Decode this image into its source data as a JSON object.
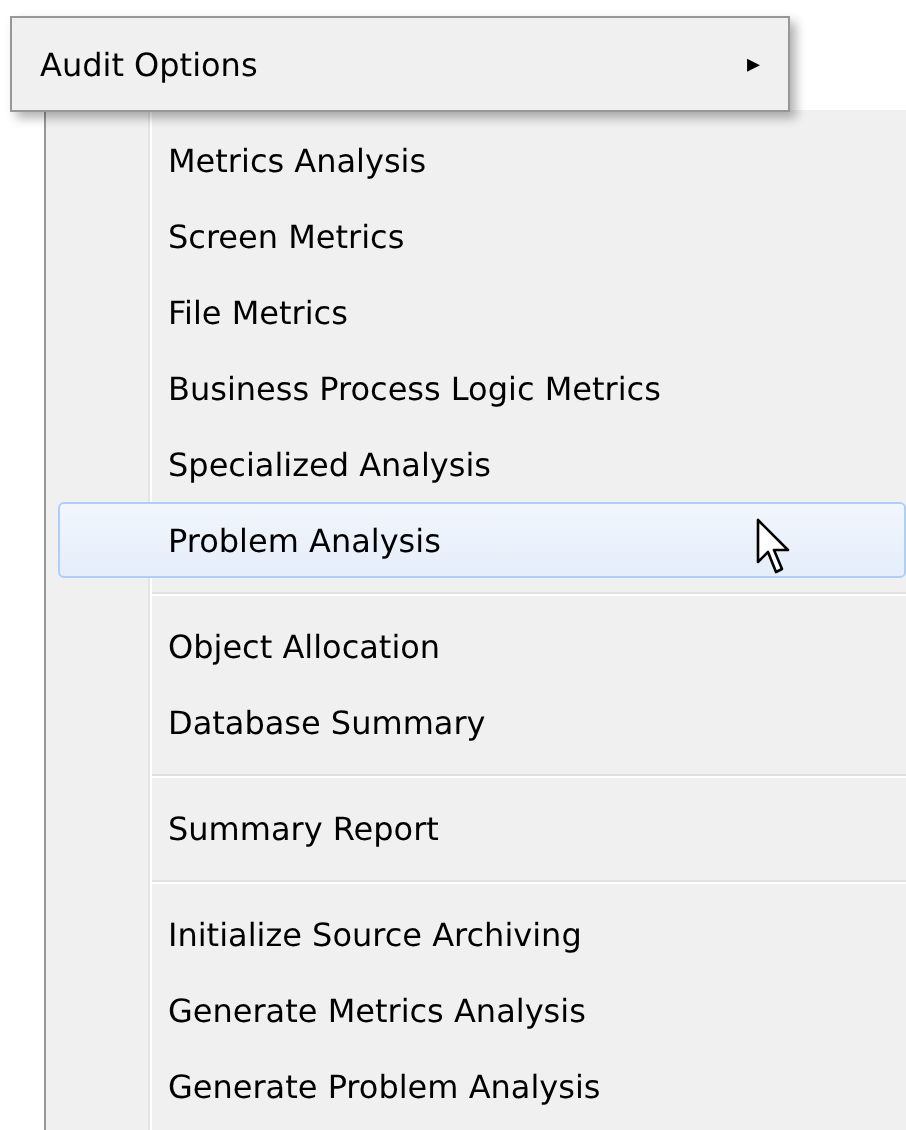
{
  "parent_menu": {
    "label": "Audit Options",
    "arrow": "▸"
  },
  "submenu": {
    "groups": [
      {
        "items": [
          {
            "label": "Metrics Analysis",
            "selected": false
          },
          {
            "label": "Screen Metrics",
            "selected": false
          },
          {
            "label": "File Metrics",
            "selected": false
          },
          {
            "label": "Business Process Logic Metrics",
            "selected": false
          },
          {
            "label": "Specialized Analysis",
            "selected": false
          },
          {
            "label": "Problem Analysis",
            "selected": true
          }
        ]
      },
      {
        "items": [
          {
            "label": "Object Allocation",
            "selected": false
          },
          {
            "label": "Database Summary",
            "selected": false
          }
        ]
      },
      {
        "items": [
          {
            "label": "Summary Report",
            "selected": false
          }
        ]
      },
      {
        "items": [
          {
            "label": "Initialize Source Archiving",
            "selected": false
          },
          {
            "label": "Generate Metrics Analysis",
            "selected": false
          },
          {
            "label": "Generate Problem Analysis",
            "selected": false
          }
        ]
      }
    ]
  }
}
